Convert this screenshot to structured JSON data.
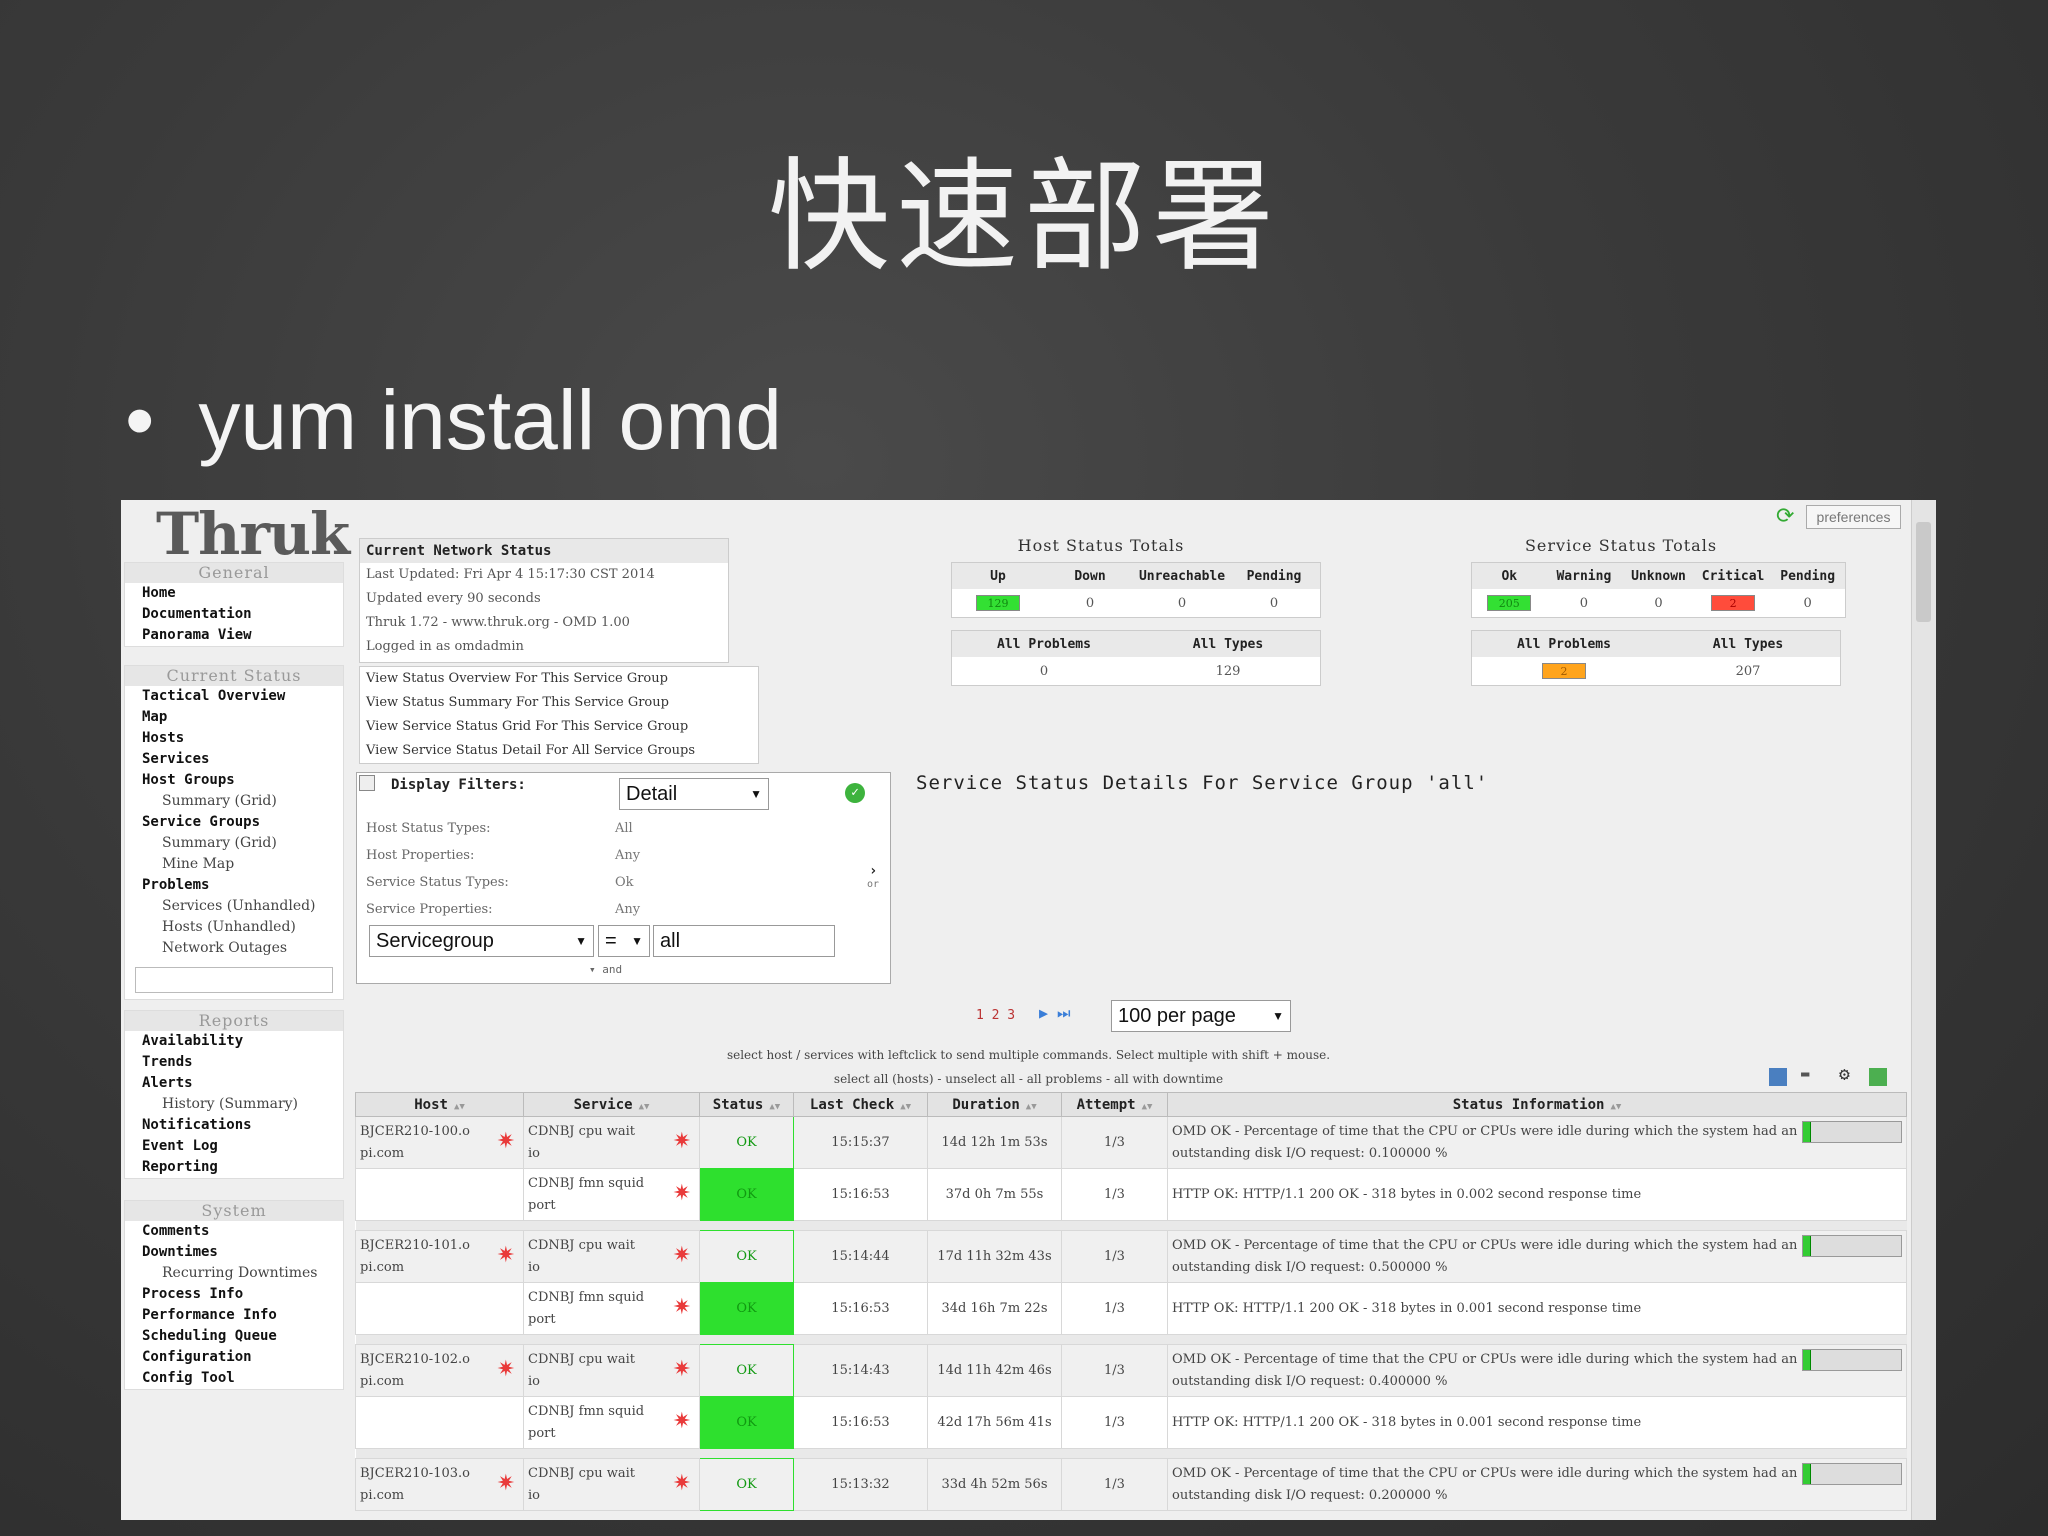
{
  "slide": {
    "title": "快速部署",
    "bullet_symbol": "•",
    "bullet": "yum install omd"
  },
  "app": {
    "logo": "Thruk",
    "preferences": "preferences"
  },
  "nav": {
    "general": {
      "heading": "General",
      "items": [
        "Home",
        "Documentation",
        "Panorama View"
      ]
    },
    "current_status": {
      "heading": "Current Status",
      "items": [
        {
          "label": "Tactical Overview",
          "sub": false
        },
        {
          "label": "Map",
          "sub": false
        },
        {
          "label": "Hosts",
          "sub": false
        },
        {
          "label": "Services",
          "sub": false
        },
        {
          "label": "Host Groups",
          "sub": false
        },
        {
          "label": "Summary (Grid)",
          "sub": true
        },
        {
          "label": "Service Groups",
          "sub": false
        },
        {
          "label": "Summary (Grid)",
          "sub": true
        },
        {
          "label": "Mine Map",
          "sub": true
        },
        {
          "label": "Problems",
          "sub": false
        },
        {
          "label": "Services (Unhandled)",
          "sub": true
        },
        {
          "label": "Hosts (Unhandled)",
          "sub": true
        },
        {
          "label": "Network Outages",
          "sub": true
        }
      ]
    },
    "reports": {
      "heading": "Reports",
      "items": [
        {
          "label": "Availability",
          "sub": false
        },
        {
          "label": "Trends",
          "sub": false
        },
        {
          "label": "Alerts",
          "sub": false
        },
        {
          "label": "History (Summary)",
          "sub": true
        },
        {
          "label": "Notifications",
          "sub": false
        },
        {
          "label": "Event Log",
          "sub": false
        },
        {
          "label": "Reporting",
          "sub": false
        }
      ]
    },
    "system": {
      "heading": "System",
      "items": [
        {
          "label": "Comments",
          "sub": false
        },
        {
          "label": "Downtimes",
          "sub": false
        },
        {
          "label": "Recurring Downtimes",
          "sub": true
        },
        {
          "label": "Process Info",
          "sub": false
        },
        {
          "label": "Performance Info",
          "sub": false
        },
        {
          "label": "Scheduling Queue",
          "sub": false
        },
        {
          "label": "Configuration",
          "sub": false
        },
        {
          "label": "Config Tool",
          "sub": false
        }
      ]
    }
  },
  "network_status": {
    "heading": "Current Network Status",
    "lines": [
      "Last Updated: Fri Apr 4 15:17:30 CST 2014",
      "Updated every 90 seconds",
      "Thruk 1.72 - www.thruk.org - OMD 1.00",
      "Logged in as omdadmin"
    ]
  },
  "view_links": [
    "View Status Overview For This Service Group",
    "View Status Summary For This Service Group",
    "View Service Status Grid For This Service Group",
    "View Service Status Detail For All Service Groups"
  ],
  "host_totals": {
    "title": "Host Status Totals",
    "headers": [
      "Up",
      "Down",
      "Unreachable",
      "Pending"
    ],
    "values": [
      "129",
      "0",
      "0",
      "0"
    ],
    "sum_headers": [
      "All Problems",
      "All Types"
    ],
    "sum_values": [
      "0",
      "129"
    ]
  },
  "service_totals": {
    "title": "Service Status Totals",
    "headers": [
      "Ok",
      "Warning",
      "Unknown",
      "Critical",
      "Pending"
    ],
    "values": [
      "205",
      "0",
      "0",
      "2",
      "0"
    ],
    "sum_headers": [
      "All Problems",
      "All Types"
    ],
    "sum_values": [
      "2",
      "207"
    ]
  },
  "filters": {
    "heading": "Display Filters:",
    "mode": "Detail",
    "rows": [
      {
        "label": "Host Status Types:",
        "value": "All"
      },
      {
        "label": "Host Properties:",
        "value": "Any"
      },
      {
        "label": "Service Status Types:",
        "value": "Ok"
      },
      {
        "label": "Service Properties:",
        "value": "Any"
      }
    ],
    "or_label": "or",
    "field": "Servicegroup",
    "operator": "=",
    "value": "all",
    "and_label": "and"
  },
  "page_title": "Service Status Details For Service Group 'all'",
  "pager": {
    "pages": "1 2 3",
    "per_page": "100 per page"
  },
  "notes": [
    "select host / services with leftclick to send multiple commands. Select multiple with shift + mouse.",
    "select all (hosts) - unselect all - all problems - all with downtime"
  ],
  "table": {
    "columns": [
      "Host",
      "Service",
      "Status",
      "Last Check",
      "Duration",
      "Attempt",
      "Status Information"
    ],
    "sort_glyph": "▲▼",
    "rows": [
      {
        "host": "BJCER210-100.opi.com",
        "service": "CDNBJ cpu wait io",
        "status": "OK",
        "last_check": "15:15:37",
        "duration": "14d 12h 1m 53s",
        "attempt": "1/3",
        "info": "OMD OK - Percentage of time that the CPU or CPUs were idle during which the system had an outstanding disk I/O request: 0.100000 %",
        "bar": 0.1
      },
      {
        "host": "",
        "service": "CDNBJ fmn squid port",
        "status": "OK",
        "last_check": "15:16:53",
        "duration": "37d 0h 7m 55s",
        "attempt": "1/3",
        "info": "HTTP OK: HTTP/1.1 200 OK - 318 bytes in 0.002 second response time",
        "bar": null
      },
      {
        "host": "BJCER210-101.opi.com",
        "service": "CDNBJ cpu wait io",
        "status": "OK",
        "last_check": "15:14:44",
        "duration": "17d 11h 32m 43s",
        "attempt": "1/3",
        "info": "OMD OK - Percentage of time that the CPU or CPUs were idle during which the system had an outstanding disk I/O request: 0.500000 %",
        "bar": 0.5
      },
      {
        "host": "",
        "service": "CDNBJ fmn squid port",
        "status": "OK",
        "last_check": "15:16:53",
        "duration": "34d 16h 7m 22s",
        "attempt": "1/3",
        "info": "HTTP OK: HTTP/1.1 200 OK - 318 bytes in 0.001 second response time",
        "bar": null
      },
      {
        "host": "BJCER210-102.opi.com",
        "service": "CDNBJ cpu wait io",
        "status": "OK",
        "last_check": "15:14:43",
        "duration": "14d 11h 42m 46s",
        "attempt": "1/3",
        "info": "OMD OK - Percentage of time that the CPU or CPUs were idle during which the system had an outstanding disk I/O request: 0.400000 %",
        "bar": 0.4
      },
      {
        "host": "",
        "service": "CDNBJ fmn squid port",
        "status": "OK",
        "last_check": "15:16:53",
        "duration": "42d 17h 56m 41s",
        "attempt": "1/3",
        "info": "HTTP OK: HTTP/1.1 200 OK - 318 bytes in 0.001 second response time",
        "bar": null
      },
      {
        "host": "BJCER210-103.opi.com",
        "service": "CDNBJ cpu wait io",
        "status": "OK",
        "last_check": "15:13:32",
        "duration": "33d 4h 52m 56s",
        "attempt": "1/3",
        "info": "OMD OK - Percentage of time that the CPU or CPUs were idle during which the system had an outstanding disk I/O request: 0.200000 %",
        "bar": 0.2
      }
    ]
  },
  "colors": {
    "ok": "#2ee02e",
    "critical": "#ff4c3b",
    "warning": "#ffa41c"
  },
  "icons": [
    "refresh-icon",
    "problem-star-icon",
    "checkmark-icon",
    "expand-arrow-icon",
    "pager-next-icon",
    "pager-last-icon",
    "export-icon",
    "settings-icon"
  ]
}
